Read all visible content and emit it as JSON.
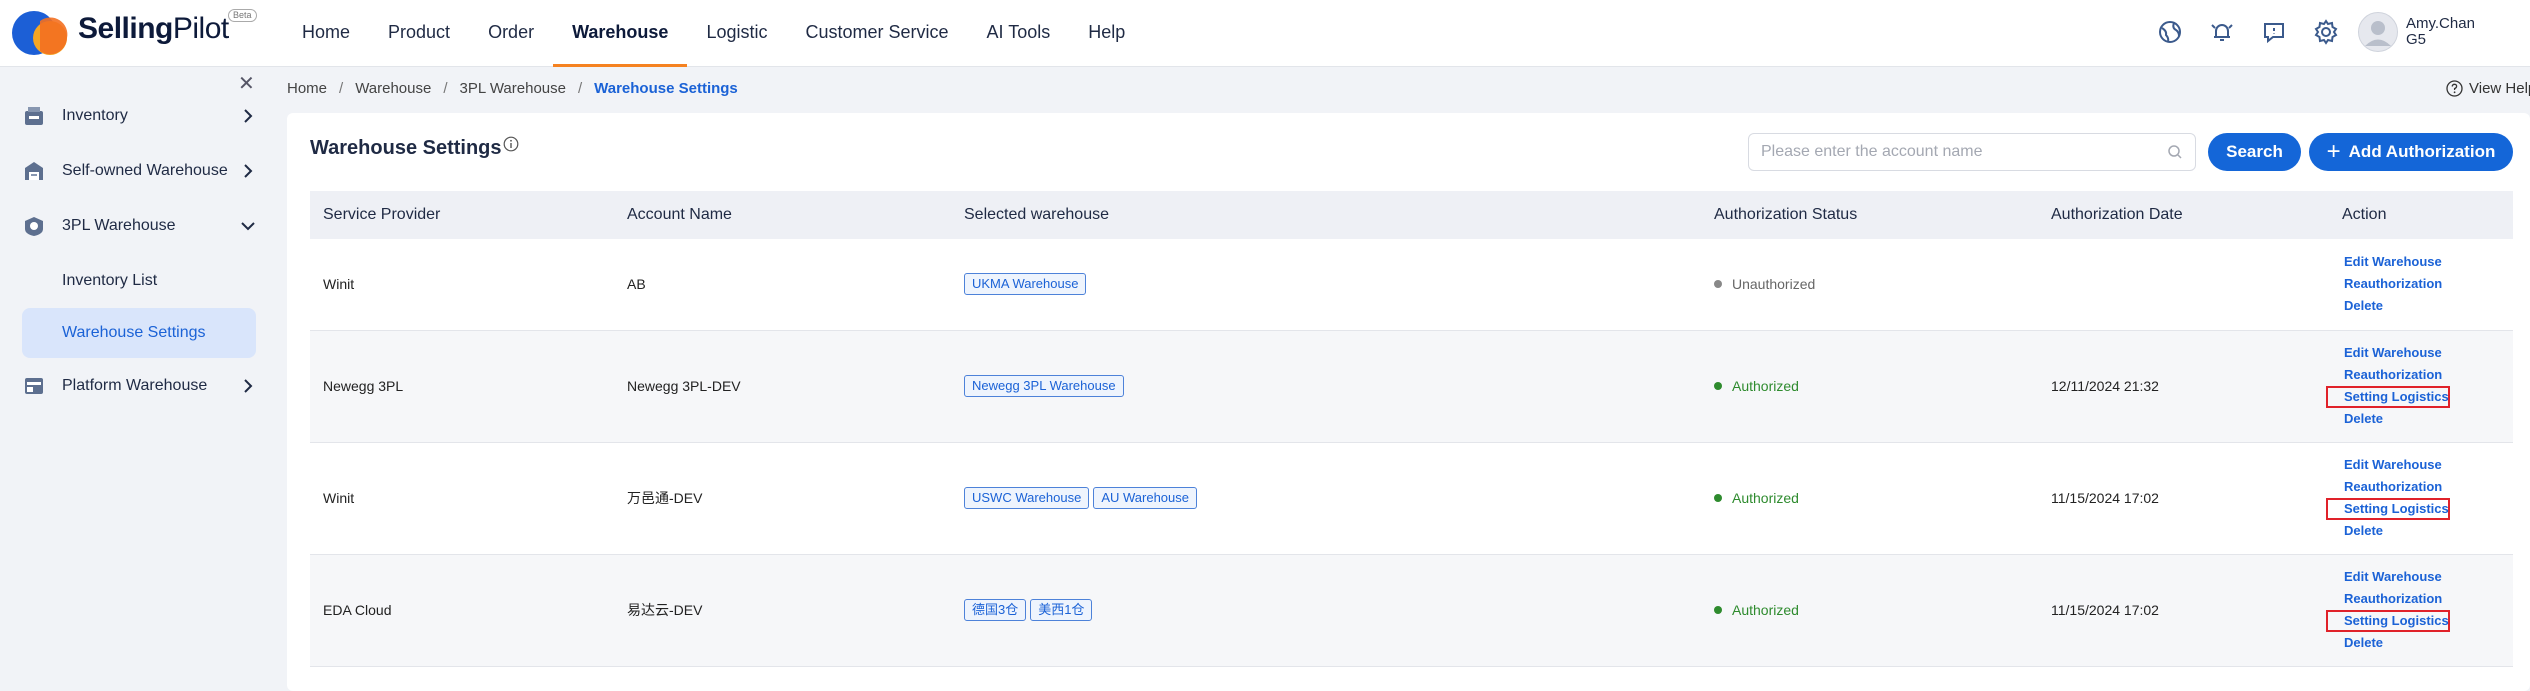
{
  "header": {
    "brand_bold": "Selling",
    "brand_light": "Pilot",
    "beta": "Beta",
    "nav": [
      "Home",
      "Product",
      "Order",
      "Warehouse",
      "Logistic",
      "Customer Service",
      "AI Tools",
      "Help"
    ],
    "active_nav": "Warehouse",
    "user": {
      "name": "Amy.Chan",
      "sub": "G5"
    }
  },
  "sidebar": {
    "items": [
      {
        "label": "Inventory",
        "icon": "inventory-icon"
      },
      {
        "label": "Self-owned Warehouse",
        "icon": "warehouse-icon"
      },
      {
        "label": "3PL Warehouse",
        "icon": "3pl-icon"
      },
      {
        "label": "Platform Warehouse",
        "icon": "platform-icon"
      }
    ],
    "sub_items": [
      {
        "label": "Inventory List"
      },
      {
        "label": "Warehouse Settings",
        "active": true
      }
    ]
  },
  "breadcrumb": [
    "Home",
    "Warehouse",
    "3PL Warehouse",
    "Warehouse Settings"
  ],
  "view_help": "View Help",
  "page": {
    "title": "Warehouse Settings",
    "search_placeholder": "Please enter the account name",
    "search_button": "Search",
    "add_button": "Add Authorization"
  },
  "table": {
    "headers": [
      "Service Provider",
      "Account Name",
      "Selected warehouse",
      "Authorization Status",
      "Authorization Date",
      "Action"
    ],
    "rows": [
      {
        "provider": "Winit",
        "account": "AB",
        "warehouses": [
          "UKMA Warehouse"
        ],
        "status": "Unauthorized",
        "date": "",
        "actions": [
          "Edit Warehouse",
          "Reauthorization",
          "Delete"
        ]
      },
      {
        "provider": "Newegg 3PL",
        "account": "Newegg 3PL-DEV",
        "warehouses": [
          "Newegg 3PL Warehouse"
        ],
        "status": "Authorized",
        "date": "12/11/2024 21:32",
        "actions": [
          "Edit Warehouse",
          "Reauthorization",
          "Setting Logistics",
          "Delete"
        ]
      },
      {
        "provider": "Winit",
        "account": "万邑通-DEV",
        "warehouses": [
          "USWC Warehouse",
          "AU Warehouse"
        ],
        "status": "Authorized",
        "date": "11/15/2024 17:02",
        "actions": [
          "Edit Warehouse",
          "Reauthorization",
          "Setting Logistics",
          "Delete"
        ]
      },
      {
        "provider": "EDA Cloud",
        "account": "易达云-DEV",
        "warehouses": [
          "德国3仓",
          "美西1仓"
        ],
        "status": "Authorized",
        "date": "11/15/2024 17:02",
        "actions": [
          "Edit Warehouse",
          "Reauthorization",
          "Setting Logistics",
          "Delete"
        ]
      }
    ]
  },
  "colors": {
    "primary": "#1466d8",
    "accent_orange": "#f58220",
    "authorized_green": "#2e8b2e",
    "highlight_red": "#e0222a"
  }
}
